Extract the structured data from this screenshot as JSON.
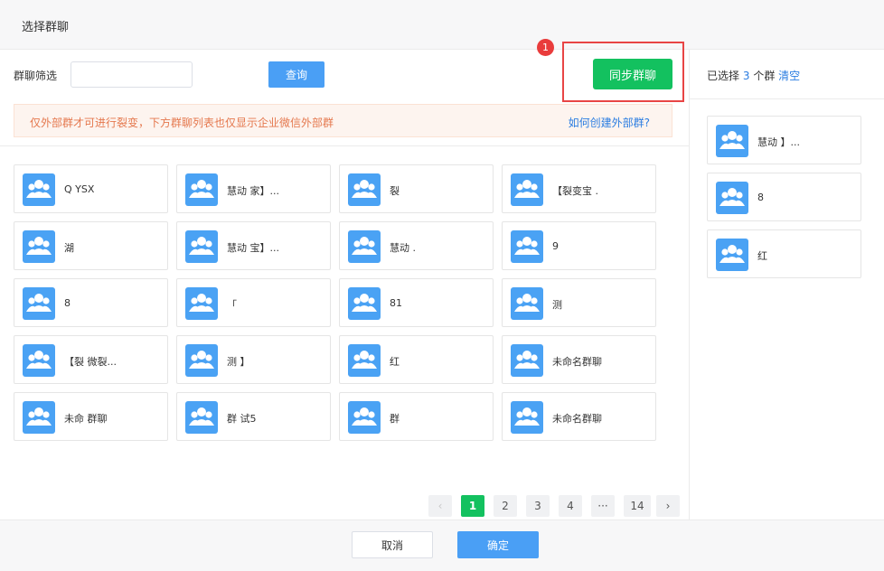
{
  "dialog": {
    "title": "选择群聊"
  },
  "filter": {
    "label": "群聊筛选",
    "input_value": "",
    "input_placeholder": "",
    "query_label": "查询"
  },
  "sync": {
    "badge": "1",
    "label": "同步群聊"
  },
  "notice": {
    "text": "仅外部群才可进行裂变，下方群聊列表也仅显示企业微信外部群",
    "link": "如何创建外部群?"
  },
  "groups": [
    {
      "name": "Q    YSX"
    },
    {
      "name": "慧动        家】..."
    },
    {
      "name": "裂"
    },
    {
      "name": "【裂变宝        ."
    },
    {
      "name": "湖"
    },
    {
      "name": "慧动        宝】..."
    },
    {
      "name": "慧动        ."
    },
    {
      "name": "9"
    },
    {
      "name": "8"
    },
    {
      "name": "「"
    },
    {
      "name": "81"
    },
    {
      "name": "测"
    },
    {
      "name": "【裂      微裂..."
    },
    {
      "name": "测      】"
    },
    {
      "name": "红"
    },
    {
      "name": "未命名群聊"
    },
    {
      "name": "未命    群聊"
    },
    {
      "name": "群      试5"
    },
    {
      "name": "群"
    },
    {
      "name": "未命名群聊"
    }
  ],
  "pagination": {
    "prev": "‹",
    "pages": [
      "1",
      "2",
      "3",
      "4"
    ],
    "ellipsis": "···",
    "last": "14",
    "next": "›",
    "current": "1"
  },
  "selected": {
    "prefix": "已选择",
    "count": "3",
    "suffix": "个群",
    "clear_label": "清空",
    "items": [
      {
        "name": "慧动        】..."
      },
      {
        "name": "8"
      },
      {
        "name": "红"
      }
    ]
  },
  "footer": {
    "cancel_label": "取消",
    "ok_label": "确定"
  },
  "colors": {
    "primary": "#4a9ff5",
    "success": "#13c15f",
    "warning_text": "#e5784e",
    "link": "#2b7de1",
    "highlight": "#e84545"
  },
  "icons": {
    "group_avatar": "group-people-icon"
  }
}
